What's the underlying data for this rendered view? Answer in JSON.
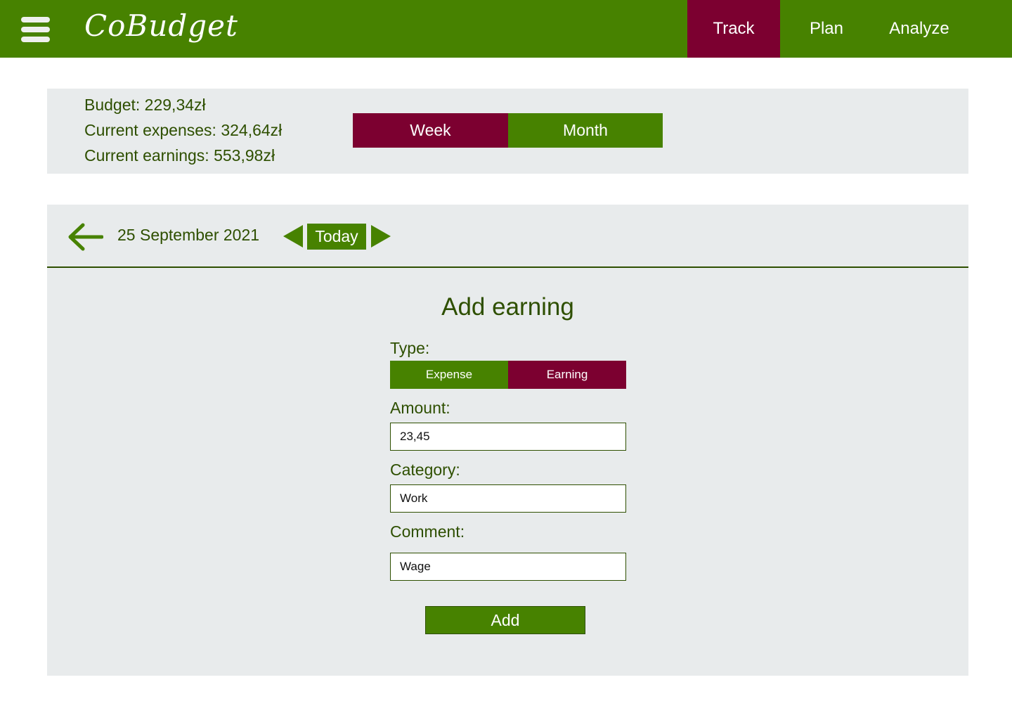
{
  "app": {
    "name": "CoBudget"
  },
  "nav": {
    "track": "Track",
    "plan": "Plan",
    "analyze": "Analyze",
    "active": "Track"
  },
  "summary": {
    "budget": "Budget: 229,34zł",
    "expenses": "Current expenses: 324,64zł",
    "earnings": "Current earnings: 553,98zł",
    "period_week": "Week",
    "period_month": "Month",
    "period_selected": "Week"
  },
  "date_nav": {
    "date": "25 September 2021",
    "today": "Today"
  },
  "form": {
    "title": "Add earning",
    "type_label": "Type:",
    "type_expense": "Expense",
    "type_earning": "Earning",
    "type_selected": "Earning",
    "amount_label": "Amount:",
    "amount_value": "23,45",
    "category_label": "Category:",
    "category_value": "Work",
    "comment_label": "Comment:",
    "comment_value": "Wage",
    "submit": "Add"
  },
  "icons": {
    "menu": "hamburger-menu-icon",
    "back": "arrow-left-icon",
    "prev": "triangle-left-icon",
    "next": "triangle-right-icon"
  },
  "colors": {
    "primary_green": "#478200",
    "active_maroon": "#7c0030",
    "panel_gray": "#e8ebec",
    "text_dark_green": "#2e4f00"
  }
}
